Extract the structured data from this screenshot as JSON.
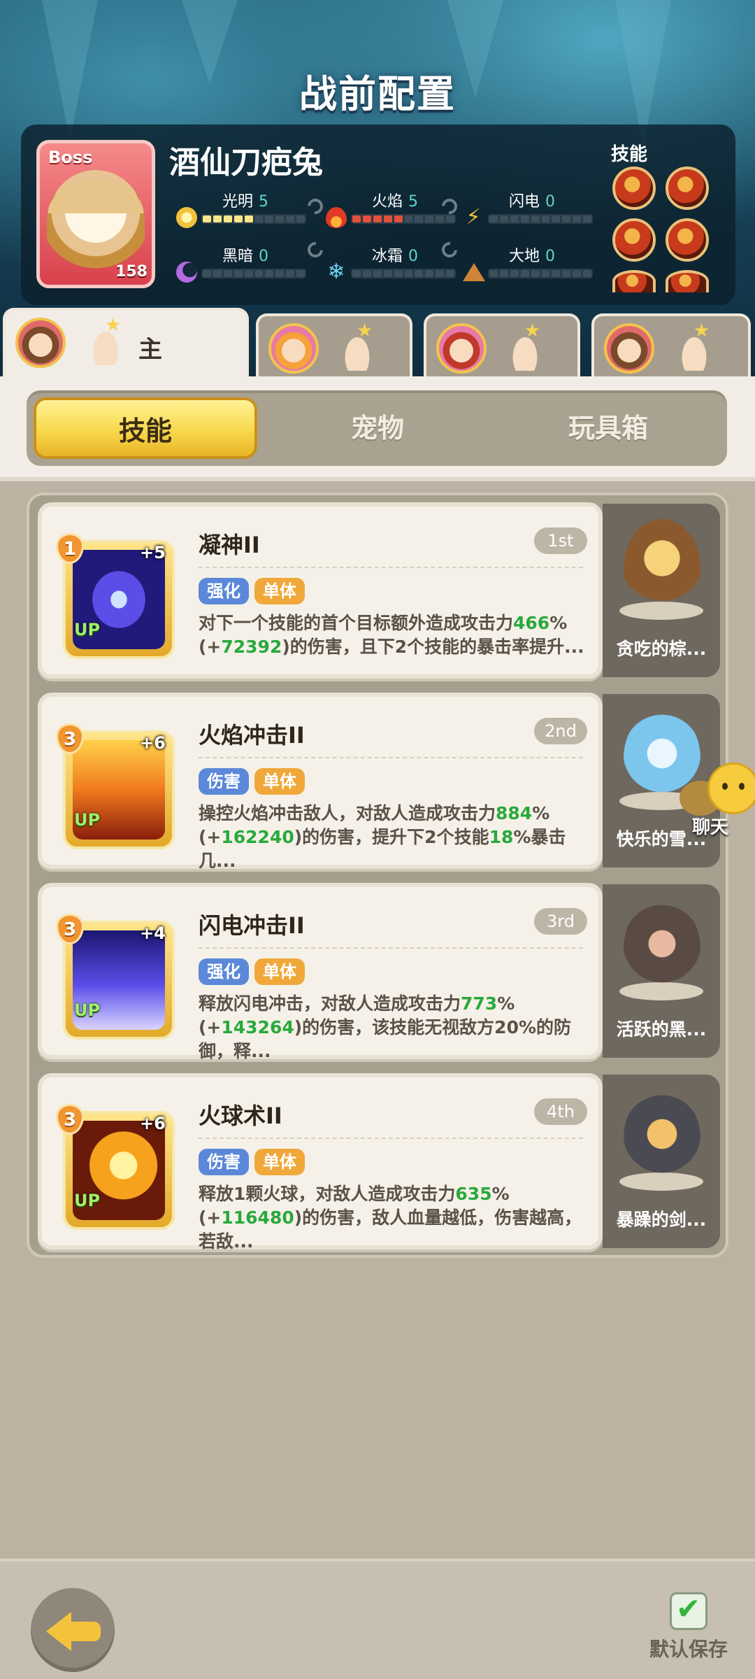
{
  "page_title": "战前配置",
  "boss": {
    "tag": "Boss",
    "level": "158",
    "name": "酒仙刀疤兔",
    "elements": [
      {
        "name": "光明",
        "value": "5",
        "icon": "sun-icon",
        "color": "#f7e68a"
      },
      {
        "name": "火焰",
        "value": "5",
        "icon": "flame-icon",
        "color": "#e4503c"
      },
      {
        "name": "闪电",
        "value": "0",
        "icon": "lightning-icon",
        "color": "#f5c23b"
      },
      {
        "name": "黑暗",
        "value": "0",
        "icon": "moon-icon",
        "color": "#b26ae0"
      },
      {
        "name": "冰霜",
        "value": "0",
        "icon": "snowflake-icon",
        "color": "#6fd3f2"
      },
      {
        "name": "大地",
        "value": "0",
        "icon": "mountain-icon",
        "color": "#d0843a"
      }
    ],
    "skills_label": "技能"
  },
  "team_tabs": [
    {
      "label": "主",
      "active": true
    },
    {
      "label": "",
      "active": false
    },
    {
      "label": "",
      "active": false
    },
    {
      "label": "",
      "active": false
    }
  ],
  "categories": [
    "技能",
    "宠物",
    "玩具箱"
  ],
  "active_category": "技能",
  "skills": [
    {
      "name": "凝神II",
      "rank": "1st",
      "cost": "1",
      "plus": "+5",
      "up": "UP",
      "tags": [
        {
          "label": "强化",
          "color": "blue"
        },
        {
          "label": "单体",
          "color": "orange"
        }
      ],
      "desc_parts": [
        {
          "t": "对下一个技能的首个目标额外造成攻击力"
        },
        {
          "t": "466",
          "g": true
        },
        {
          "t": "%(+"
        },
        {
          "t": "72392",
          "g": true
        },
        {
          "t": ")的伤害，且下2个技能的暴击率提升..."
        }
      ],
      "pet_name": "贪吃的棕..."
    },
    {
      "name": "火焰冲击II",
      "rank": "2nd",
      "cost": "3",
      "plus": "+6",
      "up": "UP",
      "tags": [
        {
          "label": "伤害",
          "color": "blue"
        },
        {
          "label": "单体",
          "color": "orange"
        }
      ],
      "desc_parts": [
        {
          "t": "操控火焰冲击敌人，对敌人造成攻击力"
        },
        {
          "t": "884",
          "g": true
        },
        {
          "t": "%(+"
        },
        {
          "t": "162240",
          "g": true
        },
        {
          "t": ")的伤害，提升下2个技能"
        },
        {
          "t": "18",
          "g": true
        },
        {
          "t": "%暴击几..."
        }
      ],
      "pet_name": "快乐的雪..."
    },
    {
      "name": "闪电冲击II",
      "rank": "3rd",
      "cost": "3",
      "plus": "+4",
      "up": "UP",
      "tags": [
        {
          "label": "强化",
          "color": "blue"
        },
        {
          "label": "单体",
          "color": "orange"
        }
      ],
      "desc_parts": [
        {
          "t": "释放闪电冲击，对敌人造成攻击力"
        },
        {
          "t": "773",
          "g": true
        },
        {
          "t": "%(+"
        },
        {
          "t": "143264",
          "g": true
        },
        {
          "t": ")的伤害，该技能无视敌方20%的防御，释..."
        }
      ],
      "pet_name": "活跃的黑..."
    },
    {
      "name": "火球术II",
      "rank": "4th",
      "cost": "3",
      "plus": "+6",
      "up": "UP",
      "tags": [
        {
          "label": "伤害",
          "color": "blue"
        },
        {
          "label": "单体",
          "color": "orange"
        }
      ],
      "desc_parts": [
        {
          "t": "释放1颗火球，对敌人造成攻击力"
        },
        {
          "t": "635",
          "g": true
        },
        {
          "t": "%(+"
        },
        {
          "t": "116480",
          "g": true
        },
        {
          "t": ")的伤害，敌人血量越低，伤害越高，若敌..."
        }
      ],
      "pet_name": "暴躁的剑..."
    }
  ],
  "chat_label": "聊天",
  "save_label": "默认保存"
}
